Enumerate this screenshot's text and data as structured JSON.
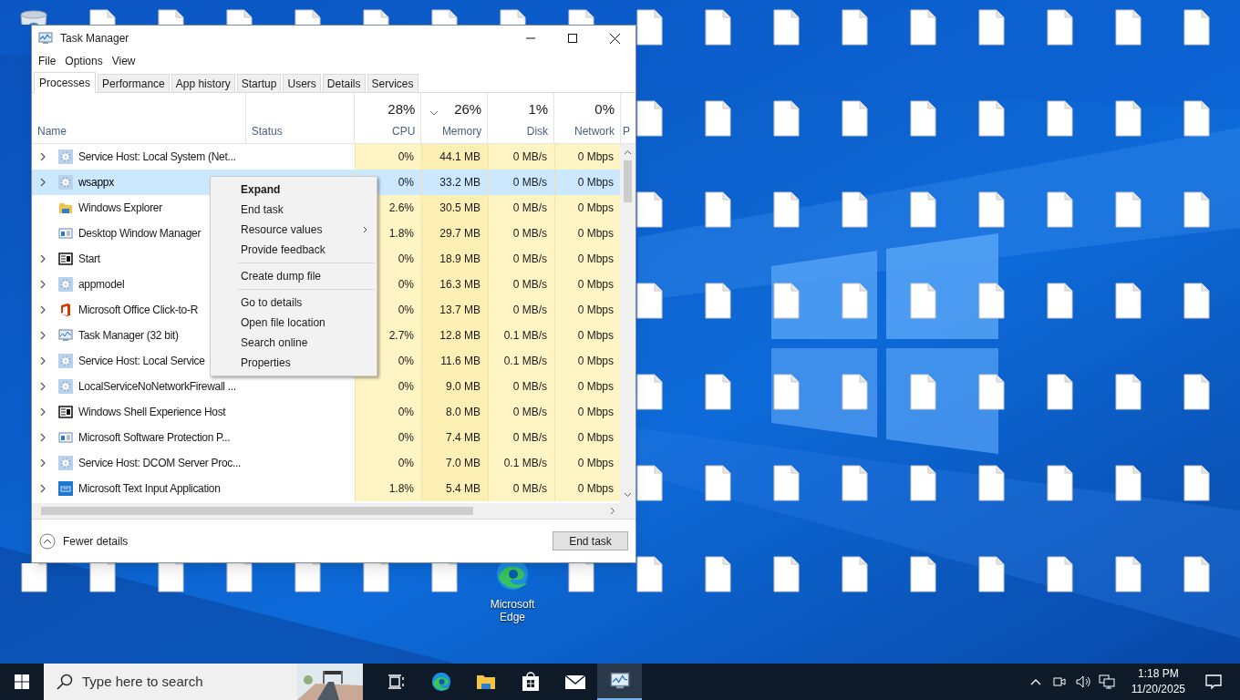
{
  "desktop": {
    "rows": [
      {
        "icons": [
          {
            "kind": "recycle-bin"
          },
          {
            "kind": "file"
          },
          {
            "kind": "file"
          },
          {
            "kind": "file"
          },
          {
            "kind": "file"
          },
          {
            "kind": "file"
          },
          {
            "kind": "file"
          },
          {
            "kind": "file"
          },
          {
            "kind": "file"
          },
          {
            "kind": "file"
          },
          {
            "kind": "file"
          },
          {
            "kind": "file"
          },
          {
            "kind": "file"
          },
          {
            "kind": "file"
          },
          {
            "kind": "file"
          },
          {
            "kind": "file"
          },
          {
            "kind": "file"
          },
          {
            "kind": "file"
          }
        ]
      },
      {
        "icons": [
          {
            "kind": "file"
          },
          {
            "kind": "file"
          },
          {
            "kind": "file"
          },
          {
            "kind": "file"
          },
          {
            "kind": "file"
          },
          {
            "kind": "file"
          },
          {
            "kind": "file"
          },
          {
            "kind": "file"
          },
          {
            "kind": "file"
          }
        ]
      },
      {
        "icons": [
          {
            "kind": "file"
          },
          {
            "kind": "file"
          },
          {
            "kind": "file"
          },
          {
            "kind": "file"
          },
          {
            "kind": "file"
          },
          {
            "kind": "file"
          },
          {
            "kind": "file"
          },
          {
            "kind": "file"
          },
          {
            "kind": "file"
          }
        ]
      },
      {
        "icons": [
          {
            "kind": "file"
          },
          {
            "kind": "file"
          },
          {
            "kind": "file"
          },
          {
            "kind": "file"
          },
          {
            "kind": "file"
          },
          {
            "kind": "file"
          },
          {
            "kind": "file"
          },
          {
            "kind": "file"
          },
          {
            "kind": "file"
          }
        ]
      },
      {
        "icons": [
          {
            "kind": "file"
          },
          {
            "kind": "file"
          },
          {
            "kind": "file"
          },
          {
            "kind": "file"
          },
          {
            "kind": "file"
          },
          {
            "kind": "file"
          },
          {
            "kind": "file"
          },
          {
            "kind": "file"
          },
          {
            "kind": "file"
          }
        ]
      },
      {
        "icons": [
          {
            "kind": "file"
          },
          {
            "kind": "file"
          },
          {
            "kind": "file"
          },
          {
            "kind": "file"
          },
          {
            "kind": "file"
          },
          {
            "kind": "file"
          },
          {
            "kind": "file"
          },
          {
            "kind": "file"
          },
          {
            "kind": "file"
          }
        ]
      },
      {
        "icons": [
          {
            "kind": "file"
          },
          {
            "kind": "file"
          },
          {
            "kind": "file"
          },
          {
            "kind": "file"
          },
          {
            "kind": "file"
          },
          {
            "kind": "file"
          },
          {
            "kind": "file"
          },
          {
            "kind": "edge",
            "label": "Microsoft Edge"
          },
          {
            "kind": "file"
          },
          {
            "kind": "file"
          },
          {
            "kind": "file"
          },
          {
            "kind": "file"
          },
          {
            "kind": "file"
          },
          {
            "kind": "file"
          },
          {
            "kind": "file"
          },
          {
            "kind": "file"
          },
          {
            "kind": "file"
          },
          {
            "kind": "file"
          }
        ]
      }
    ]
  },
  "task_manager": {
    "title": "Task Manager",
    "menu": [
      "File",
      "Options",
      "View"
    ],
    "tabs": [
      {
        "label": "Processes",
        "selected": true
      },
      {
        "label": "Performance",
        "selected": false
      },
      {
        "label": "App history",
        "selected": false
      },
      {
        "label": "Startup",
        "selected": false
      },
      {
        "label": "Users",
        "selected": false
      },
      {
        "label": "Details",
        "selected": false
      },
      {
        "label": "Services",
        "selected": false
      }
    ],
    "columns": [
      {
        "label": "Name",
        "sorted": false
      },
      {
        "label": "Status",
        "sorted": false
      },
      {
        "label": "CPU",
        "usage": "28%",
        "sorted": false
      },
      {
        "label": "Memory",
        "usage": "26%",
        "sorted": true
      },
      {
        "label": "Disk",
        "usage": "1%",
        "sorted": false
      },
      {
        "label": "Network",
        "usage": "0%",
        "sorted": false
      },
      {
        "label": "P",
        "sorted": false
      }
    ],
    "rows": [
      {
        "name": "Service Host: Local System (Net...",
        "kind": "gear",
        "expandable": true,
        "selected": false,
        "cpu": "0%",
        "memory": "44.1 MB",
        "disk": "0 MB/s",
        "network": "0 Mbps"
      },
      {
        "name": "wsappx",
        "kind": "gear",
        "expandable": true,
        "selected": true,
        "cpu": "0%",
        "memory": "33.2 MB",
        "disk": "0 MB/s",
        "network": "0 Mbps"
      },
      {
        "name": "Windows Explorer",
        "kind": "folder",
        "expandable": false,
        "selected": false,
        "cpu": "2.6%",
        "memory": "30.5 MB",
        "disk": "0 MB/s",
        "network": "0 Mbps"
      },
      {
        "name": "Desktop Window Manager",
        "kind": "window",
        "expandable": false,
        "selected": false,
        "cpu": "1.8%",
        "memory": "29.7 MB",
        "disk": "0 MB/s",
        "network": "0 Mbps"
      },
      {
        "name": "Start",
        "kind": "dark-window",
        "expandable": true,
        "selected": false,
        "cpu": "0%",
        "memory": "18.9 MB",
        "disk": "0 MB/s",
        "network": "0 Mbps"
      },
      {
        "name": "appmodel",
        "kind": "gear",
        "expandable": true,
        "selected": false,
        "cpu": "0%",
        "memory": "16.3 MB",
        "disk": "0 MB/s",
        "network": "0 Mbps"
      },
      {
        "name": "Microsoft Office Click-to-R",
        "kind": "office",
        "expandable": true,
        "selected": false,
        "cpu": "0%",
        "memory": "13.7 MB",
        "disk": "0 MB/s",
        "network": "0 Mbps"
      },
      {
        "name": "Task Manager (32 bit)",
        "kind": "monitor",
        "expandable": true,
        "selected": false,
        "cpu": "2.7%",
        "memory": "12.8 MB",
        "disk": "0.1 MB/s",
        "network": "0 Mbps"
      },
      {
        "name": "Service Host: Local Service",
        "kind": "gear",
        "expandable": true,
        "selected": false,
        "cpu": "0%",
        "memory": "11.6 MB",
        "disk": "0.1 MB/s",
        "network": "0 Mbps"
      },
      {
        "name": "LocalServiceNoNetworkFirewall ...",
        "kind": "gear",
        "expandable": true,
        "selected": false,
        "cpu": "0%",
        "memory": "9.0 MB",
        "disk": "0 MB/s",
        "network": "0 Mbps"
      },
      {
        "name": "Windows Shell Experience Host",
        "kind": "dark-window",
        "expandable": true,
        "selected": false,
        "cpu": "0%",
        "memory": "8.0 MB",
        "disk": "0 MB/s",
        "network": "0 Mbps"
      },
      {
        "name": "Microsoft Software Protection P...",
        "kind": "window",
        "expandable": true,
        "selected": false,
        "cpu": "0%",
        "memory": "7.4 MB",
        "disk": "0 MB/s",
        "network": "0 Mbps"
      },
      {
        "name": "Service Host: DCOM Server Proc...",
        "kind": "gear",
        "expandable": true,
        "selected": false,
        "cpu": "0%",
        "memory": "7.0 MB",
        "disk": "0.1 MB/s",
        "network": "0 Mbps"
      },
      {
        "name": "Microsoft Text Input Application",
        "kind": "keyboard",
        "expandable": true,
        "selected": false,
        "cpu": "1.8%",
        "memory": "5.4 MB",
        "disk": "0 MB/s",
        "network": "0 Mbps"
      }
    ],
    "footer": {
      "toggle": "Fewer details",
      "button": "End task"
    }
  },
  "context_menu": [
    {
      "kind": "default",
      "label": "Expand"
    },
    {
      "kind": "item",
      "label": "End task"
    },
    {
      "kind": "submenu",
      "label": "Resource values"
    },
    {
      "kind": "item",
      "label": "Provide feedback"
    },
    {
      "kind": "separator"
    },
    {
      "kind": "item",
      "label": "Create dump file"
    },
    {
      "kind": "separator"
    },
    {
      "kind": "item",
      "label": "Go to details"
    },
    {
      "kind": "item",
      "label": "Open file location"
    },
    {
      "kind": "item",
      "label": "Search online"
    },
    {
      "kind": "item",
      "label": "Properties"
    }
  ],
  "taskbar": {
    "search_placeholder": "Type here to search",
    "apps": [
      {
        "kind": "task-view",
        "active": false
      },
      {
        "kind": "edge",
        "active": false
      },
      {
        "kind": "folder",
        "active": false
      },
      {
        "kind": "store",
        "active": false
      },
      {
        "kind": "mail",
        "active": false
      },
      {
        "kind": "monitor",
        "active": true
      }
    ],
    "clock": {
      "time": "1:18 PM",
      "date": "11/20/2025"
    }
  }
}
